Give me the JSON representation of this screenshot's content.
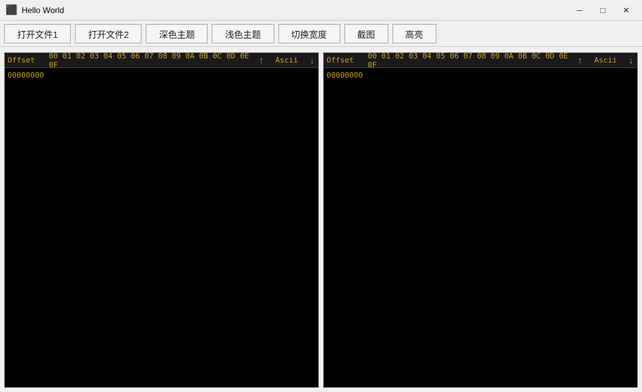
{
  "window": {
    "title": "Hello World",
    "icon": "app-icon"
  },
  "title_bar": {
    "minimize_label": "─",
    "maximize_label": "□",
    "close_label": "✕"
  },
  "toolbar": {
    "btn1": "打开文件1",
    "btn2": "打开文件2",
    "btn3": "深色主题",
    "btn4": "浅色主题",
    "btn5": "切换宽度",
    "btn6": "截图",
    "btn7": "高亮"
  },
  "hex_viewer_left": {
    "header": {
      "offset": "Offset",
      "hex": "00 01 02 03 04 05 06 07 08 09 0A 0B 0C 0D 0E 0F",
      "up_icon": "↑",
      "ascii": "Ascii",
      "down_icon": "↓"
    },
    "first_offset": "00000000"
  },
  "hex_viewer_right": {
    "header": {
      "offset": "Offset",
      "hex": "00 01 02 03 04 05 06 07 08 09 0A 0B 0C 0D 0E 0F",
      "up_icon": "↑",
      "ascii": "Ascii",
      "down_icon": "↓"
    },
    "first_offset": "00000000"
  }
}
